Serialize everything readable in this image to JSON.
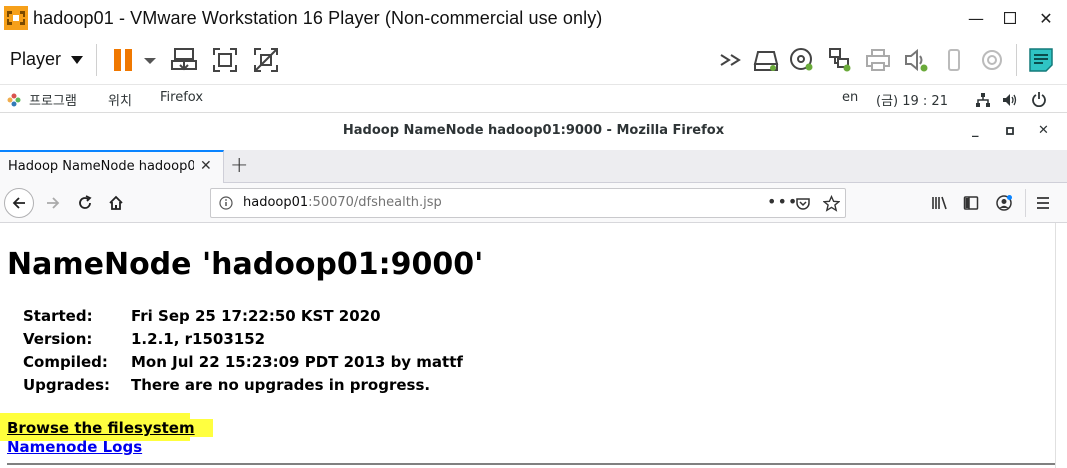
{
  "vmware": {
    "title": "hadoop01 - VMware Workstation 16 Player (Non-commercial use only)",
    "player_menu": "Player",
    "accent": "#f07800"
  },
  "guest_bar": {
    "applications": "프로그램",
    "places": "위치",
    "firefox": "Firefox",
    "input_lang": "en",
    "clock": "(금) 19 : 21"
  },
  "firefox": {
    "window_title": "Hadoop NameNode hadoop01:9000 - Mozilla Firefox",
    "tab_label": "Hadoop NameNode hadoop01:9000",
    "url_host": "hadoop01",
    "url_rest": ":50070/dfshealth.jsp"
  },
  "page": {
    "heading": "NameNode 'hadoop01:9000'",
    "info": [
      {
        "key": "Started:",
        "value": "Fri Sep 25 17:22:50 KST 2020"
      },
      {
        "key": "Version:",
        "value": "1.2.1, r1503152"
      },
      {
        "key": "Compiled:",
        "value": "Mon Jul 22 15:23:09 PDT 2013 by mattf"
      },
      {
        "key": "Upgrades:",
        "value": "There are no upgrades in progress."
      }
    ],
    "links": {
      "browse": "Browse the filesystem",
      "logs": "Namenode Logs"
    },
    "highlight_color": "#ffff3c",
    "link_color": "#0000ee"
  }
}
